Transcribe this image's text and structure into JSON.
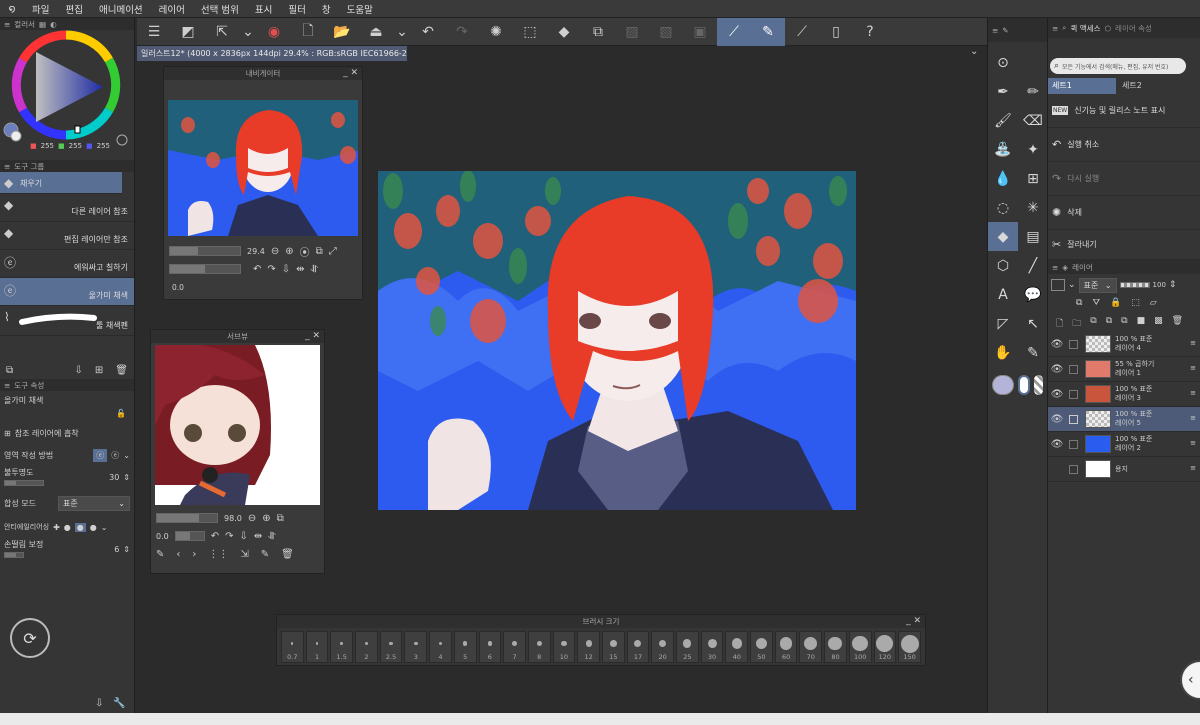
{
  "menu": {
    "logo": "໑",
    "items": [
      "파일",
      "편집",
      "애니메이션",
      "레이어",
      "선택 범위",
      "표시",
      "필터",
      "창",
      "도움말"
    ]
  },
  "document_tab": {
    "title": "일러스트12* (4000 x 2836px 144dpi 29.4% : RGB:sRGB IEC61966-2.1)",
    "close": "●"
  },
  "color_panel": {
    "tab_label": "컬러서",
    "r": "255",
    "g": "255",
    "b": "255"
  },
  "tool_panel": {
    "header": "도구 그룹",
    "active_tool": "채우기",
    "items": [
      "다른 레이어 참조",
      "편집 레이어만 참조",
      "에워싸고 칠하기",
      "울가미 채색",
      "툴 채색펜"
    ]
  },
  "tool_props": {
    "header": "도구 속성",
    "tool_name": "올가미 채색",
    "ref_layer": "참조 레이어에 흡착",
    "area_mode_label": "영역 작성 방법",
    "opacity_label": "불투명도",
    "opacity_value": "30",
    "blend_label": "합성 모드",
    "blend_value": "표준",
    "aa_label": "안티에일리어싱",
    "stab_label": "손떨림 보정",
    "stab_value": "6"
  },
  "navigator": {
    "title": "내비게이터",
    "zoom": "29.4",
    "angle": "0.0"
  },
  "subview": {
    "title": "서브뷰",
    "zoom": "98.0",
    "angle": "0.0"
  },
  "brush_size": {
    "title": "브러시 크기",
    "sizes": [
      "0.7",
      "1",
      "1.5",
      "2",
      "2.5",
      "3",
      "4",
      "5",
      "6",
      "7",
      "8",
      "10",
      "12",
      "15",
      "17",
      "20",
      "25",
      "30",
      "40",
      "50",
      "60",
      "70",
      "80",
      "100",
      "120",
      "150"
    ]
  },
  "quick_access": {
    "tab1": "퀵 액세스",
    "tab2": "레이어 속성",
    "search_placeholder": "모든 기능에서 검색(메뉴, 편집, 유저 번호)",
    "set1": "세트1",
    "set2": "세트2",
    "items": [
      {
        "label": "신기능 및 릴리스 노트 표시",
        "icon": "new-icon"
      },
      {
        "label": "실행 취소",
        "icon": "undo-icon"
      },
      {
        "label": "다시 실행",
        "icon": "redo-icon"
      },
      {
        "label": "삭제",
        "icon": "delete-icon"
      },
      {
        "label": "잘라내기",
        "icon": "scissors-icon"
      }
    ]
  },
  "layers": {
    "header": "레이어",
    "blend_mode": "표준",
    "opacity": "100",
    "items": [
      {
        "line1": "100 % 표준",
        "line2": "레이어 4",
        "thumb": "#e8e8e8",
        "selected": false
      },
      {
        "line1": "55 % 곱하기",
        "line2": "레이어 1",
        "thumb": "#e07a6a",
        "selected": false
      },
      {
        "line1": "100 % 표준",
        "line2": "레이어 3",
        "thumb": "#c9553d",
        "selected": false
      },
      {
        "line1": "100 % 표준",
        "line2": "레이어 5",
        "thumb": "#e8e8e8",
        "selected": true
      },
      {
        "line1": "100 % 표준",
        "line2": "레이어 2",
        "thumb": "#2a5cf0",
        "selected": false
      },
      {
        "line1": "",
        "line2": "용지",
        "thumb": "#ffffff",
        "selected": false
      }
    ]
  },
  "colors": {
    "accent": "#5a6f94",
    "canvas_bg": "#2c5cf0"
  }
}
